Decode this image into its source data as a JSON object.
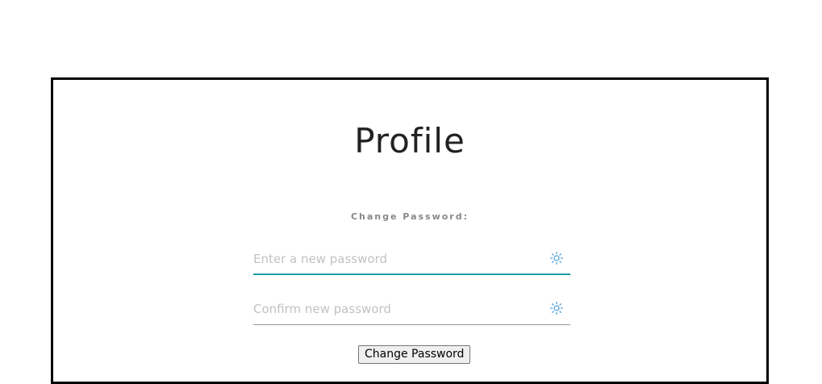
{
  "profile": {
    "title": "Profile",
    "section_label": "Change Password:",
    "new_password": {
      "placeholder": "Enter a new password",
      "value": "",
      "toggle_icon": "reveal-password-icon"
    },
    "confirm_password": {
      "placeholder": "Confirm new password",
      "value": "",
      "toggle_icon": "reveal-password-icon"
    },
    "submit_label": "Change Password"
  },
  "colors": {
    "active_underline": "#1a9fa6",
    "inactive_underline": "#999999",
    "icon": "#4a9fd8",
    "border": "#000000"
  }
}
